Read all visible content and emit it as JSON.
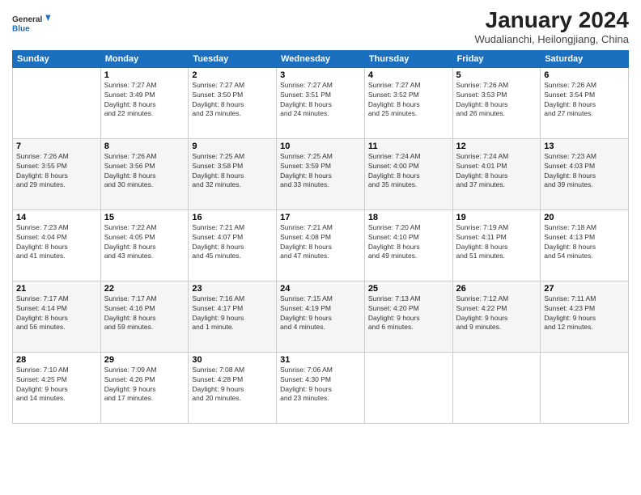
{
  "header": {
    "logo_line1": "General",
    "logo_line2": "Blue",
    "title": "January 2024",
    "subtitle": "Wudalianchi, Heilongjiang, China"
  },
  "calendar": {
    "headers": [
      "Sunday",
      "Monday",
      "Tuesday",
      "Wednesday",
      "Thursday",
      "Friday",
      "Saturday"
    ],
    "weeks": [
      [
        {
          "day": "",
          "info": ""
        },
        {
          "day": "1",
          "info": "Sunrise: 7:27 AM\nSunset: 3:49 PM\nDaylight: 8 hours\nand 22 minutes."
        },
        {
          "day": "2",
          "info": "Sunrise: 7:27 AM\nSunset: 3:50 PM\nDaylight: 8 hours\nand 23 minutes."
        },
        {
          "day": "3",
          "info": "Sunrise: 7:27 AM\nSunset: 3:51 PM\nDaylight: 8 hours\nand 24 minutes."
        },
        {
          "day": "4",
          "info": "Sunrise: 7:27 AM\nSunset: 3:52 PM\nDaylight: 8 hours\nand 25 minutes."
        },
        {
          "day": "5",
          "info": "Sunrise: 7:26 AM\nSunset: 3:53 PM\nDaylight: 8 hours\nand 26 minutes."
        },
        {
          "day": "6",
          "info": "Sunrise: 7:26 AM\nSunset: 3:54 PM\nDaylight: 8 hours\nand 27 minutes."
        }
      ],
      [
        {
          "day": "7",
          "info": "Sunrise: 7:26 AM\nSunset: 3:55 PM\nDaylight: 8 hours\nand 29 minutes."
        },
        {
          "day": "8",
          "info": "Sunrise: 7:26 AM\nSunset: 3:56 PM\nDaylight: 8 hours\nand 30 minutes."
        },
        {
          "day": "9",
          "info": "Sunrise: 7:25 AM\nSunset: 3:58 PM\nDaylight: 8 hours\nand 32 minutes."
        },
        {
          "day": "10",
          "info": "Sunrise: 7:25 AM\nSunset: 3:59 PM\nDaylight: 8 hours\nand 33 minutes."
        },
        {
          "day": "11",
          "info": "Sunrise: 7:24 AM\nSunset: 4:00 PM\nDaylight: 8 hours\nand 35 minutes."
        },
        {
          "day": "12",
          "info": "Sunrise: 7:24 AM\nSunset: 4:01 PM\nDaylight: 8 hours\nand 37 minutes."
        },
        {
          "day": "13",
          "info": "Sunrise: 7:23 AM\nSunset: 4:03 PM\nDaylight: 8 hours\nand 39 minutes."
        }
      ],
      [
        {
          "day": "14",
          "info": "Sunrise: 7:23 AM\nSunset: 4:04 PM\nDaylight: 8 hours\nand 41 minutes."
        },
        {
          "day": "15",
          "info": "Sunrise: 7:22 AM\nSunset: 4:05 PM\nDaylight: 8 hours\nand 43 minutes."
        },
        {
          "day": "16",
          "info": "Sunrise: 7:21 AM\nSunset: 4:07 PM\nDaylight: 8 hours\nand 45 minutes."
        },
        {
          "day": "17",
          "info": "Sunrise: 7:21 AM\nSunset: 4:08 PM\nDaylight: 8 hours\nand 47 minutes."
        },
        {
          "day": "18",
          "info": "Sunrise: 7:20 AM\nSunset: 4:10 PM\nDaylight: 8 hours\nand 49 minutes."
        },
        {
          "day": "19",
          "info": "Sunrise: 7:19 AM\nSunset: 4:11 PM\nDaylight: 8 hours\nand 51 minutes."
        },
        {
          "day": "20",
          "info": "Sunrise: 7:18 AM\nSunset: 4:13 PM\nDaylight: 8 hours\nand 54 minutes."
        }
      ],
      [
        {
          "day": "21",
          "info": "Sunrise: 7:17 AM\nSunset: 4:14 PM\nDaylight: 8 hours\nand 56 minutes."
        },
        {
          "day": "22",
          "info": "Sunrise: 7:17 AM\nSunset: 4:16 PM\nDaylight: 8 hours\nand 59 minutes."
        },
        {
          "day": "23",
          "info": "Sunrise: 7:16 AM\nSunset: 4:17 PM\nDaylight: 9 hours\nand 1 minute."
        },
        {
          "day": "24",
          "info": "Sunrise: 7:15 AM\nSunset: 4:19 PM\nDaylight: 9 hours\nand 4 minutes."
        },
        {
          "day": "25",
          "info": "Sunrise: 7:13 AM\nSunset: 4:20 PM\nDaylight: 9 hours\nand 6 minutes."
        },
        {
          "day": "26",
          "info": "Sunrise: 7:12 AM\nSunset: 4:22 PM\nDaylight: 9 hours\nand 9 minutes."
        },
        {
          "day": "27",
          "info": "Sunrise: 7:11 AM\nSunset: 4:23 PM\nDaylight: 9 hours\nand 12 minutes."
        }
      ],
      [
        {
          "day": "28",
          "info": "Sunrise: 7:10 AM\nSunset: 4:25 PM\nDaylight: 9 hours\nand 14 minutes."
        },
        {
          "day": "29",
          "info": "Sunrise: 7:09 AM\nSunset: 4:26 PM\nDaylight: 9 hours\nand 17 minutes."
        },
        {
          "day": "30",
          "info": "Sunrise: 7:08 AM\nSunset: 4:28 PM\nDaylight: 9 hours\nand 20 minutes."
        },
        {
          "day": "31",
          "info": "Sunrise: 7:06 AM\nSunset: 4:30 PM\nDaylight: 9 hours\nand 23 minutes."
        },
        {
          "day": "",
          "info": ""
        },
        {
          "day": "",
          "info": ""
        },
        {
          "day": "",
          "info": ""
        }
      ]
    ]
  }
}
